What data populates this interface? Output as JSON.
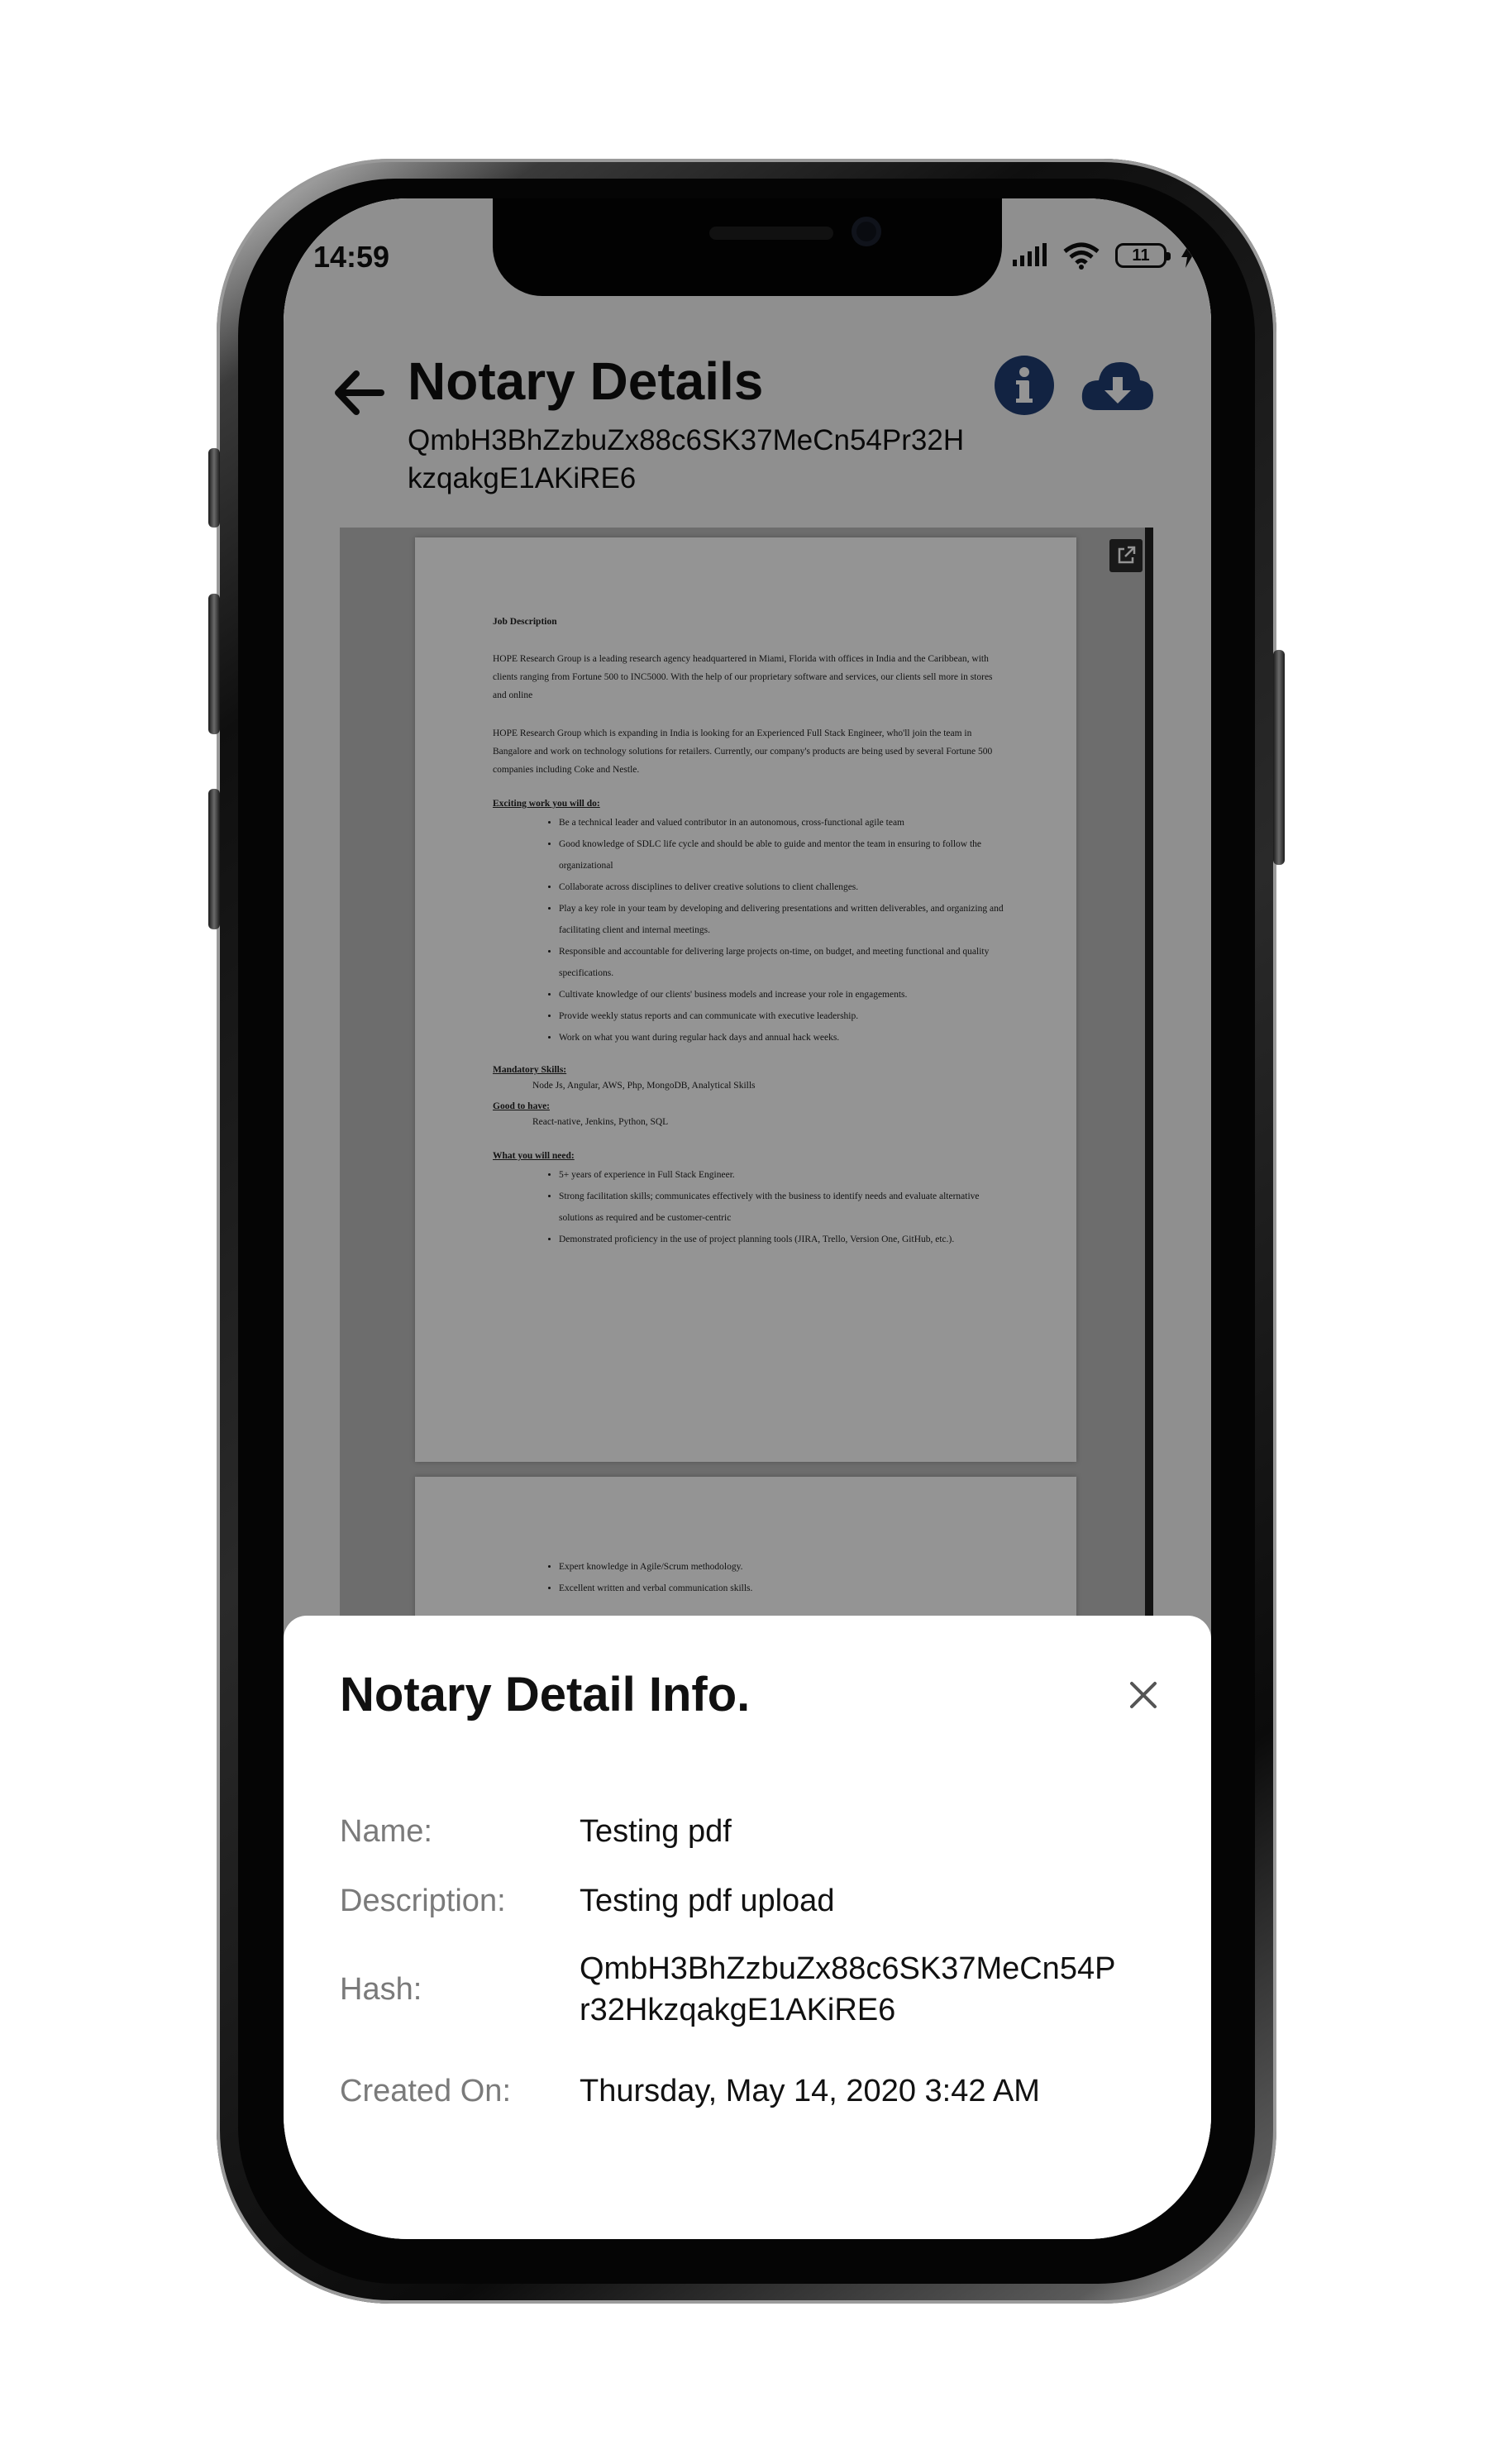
{
  "status_bar": {
    "time": "14:59",
    "battery": "11"
  },
  "header": {
    "title": "Notary Details",
    "hash_line1": "QmbH3BhZzbuZx88c6SK37MeCn54Pr32H",
    "hash_line2": "kzqakgE1AKiRE6",
    "info_icon": "info-icon",
    "download_icon": "cloud-download-icon",
    "back_icon": "arrow-left-icon"
  },
  "pdf": {
    "page1": {
      "heading": "Job Description",
      "para1": "HOPE Research Group is a leading research agency headquartered in Miami, Florida with offices in India and the Caribbean, with clients ranging from Fortune 500 to INC5000. With the help of our proprietary software and services, our clients sell more in stores and online",
      "para2": "HOPE Research Group which is expanding in India is looking for an Experienced Full Stack Engineer, who'll join the team in Bangalore and work on technology solutions for retailers. Currently, our company's products are being used by several Fortune 500 companies including Coke and Nestle.",
      "exciting_title": "Exciting work you will do:",
      "exciting_items": [
        "Be a technical leader and valued contributor in an autonomous, cross-functional agile team",
        "Good knowledge of SDLC life cycle and should be able to guide and mentor the team in ensuring to follow the organizational",
        "Collaborate across disciplines to deliver creative solutions to client challenges.",
        "Play a key role in your team by developing and delivering presentations and written deliverables, and organizing and facilitating client and internal meetings.",
        "Responsible and accountable for delivering large projects on-time, on budget, and meeting functional and quality specifications.",
        "Cultivate knowledge of our clients' business models and increase your role in engagements.",
        "Provide weekly status reports and can communicate with executive leadership.",
        "Work on what you want during regular hack days and annual hack weeks."
      ],
      "mandatory_title": "Mandatory Skills:",
      "mandatory_text": "Node Js, Angular, AWS, Php, MongoDB, Analytical Skills",
      "good_title": "Good to have:",
      "good_text": "React-native, Jenkins, Python, SQL",
      "need_title": "What you will need:",
      "need_items": [
        "5+ years of experience in Full Stack Engineer.",
        "Strong facilitation skills; communicates effectively with the business to identify needs and evaluate alternative solutions as required and be customer-centric",
        "Demonstrated proficiency in the use of project planning tools (JIRA, Trello, Version One, GitHub, etc.)."
      ]
    },
    "page2": {
      "items": [
        "Expert knowledge in Agile/Scrum methodology.",
        "Excellent written and verbal communication skills."
      ]
    }
  },
  "info_sheet": {
    "title": "Notary Detail Info.",
    "rows": [
      {
        "label": "Name:",
        "value": "Testing pdf"
      },
      {
        "label": "Description:",
        "value": "Testing pdf upload"
      },
      {
        "label": "Hash:",
        "value": "QmbH3BhZzbuZx88c6SK37MeCn54Pr32HkzqakgE1AKiRE6"
      },
      {
        "label": "Created On:",
        "value": "Thursday, May 14, 2020 3:42 AM"
      }
    ]
  }
}
